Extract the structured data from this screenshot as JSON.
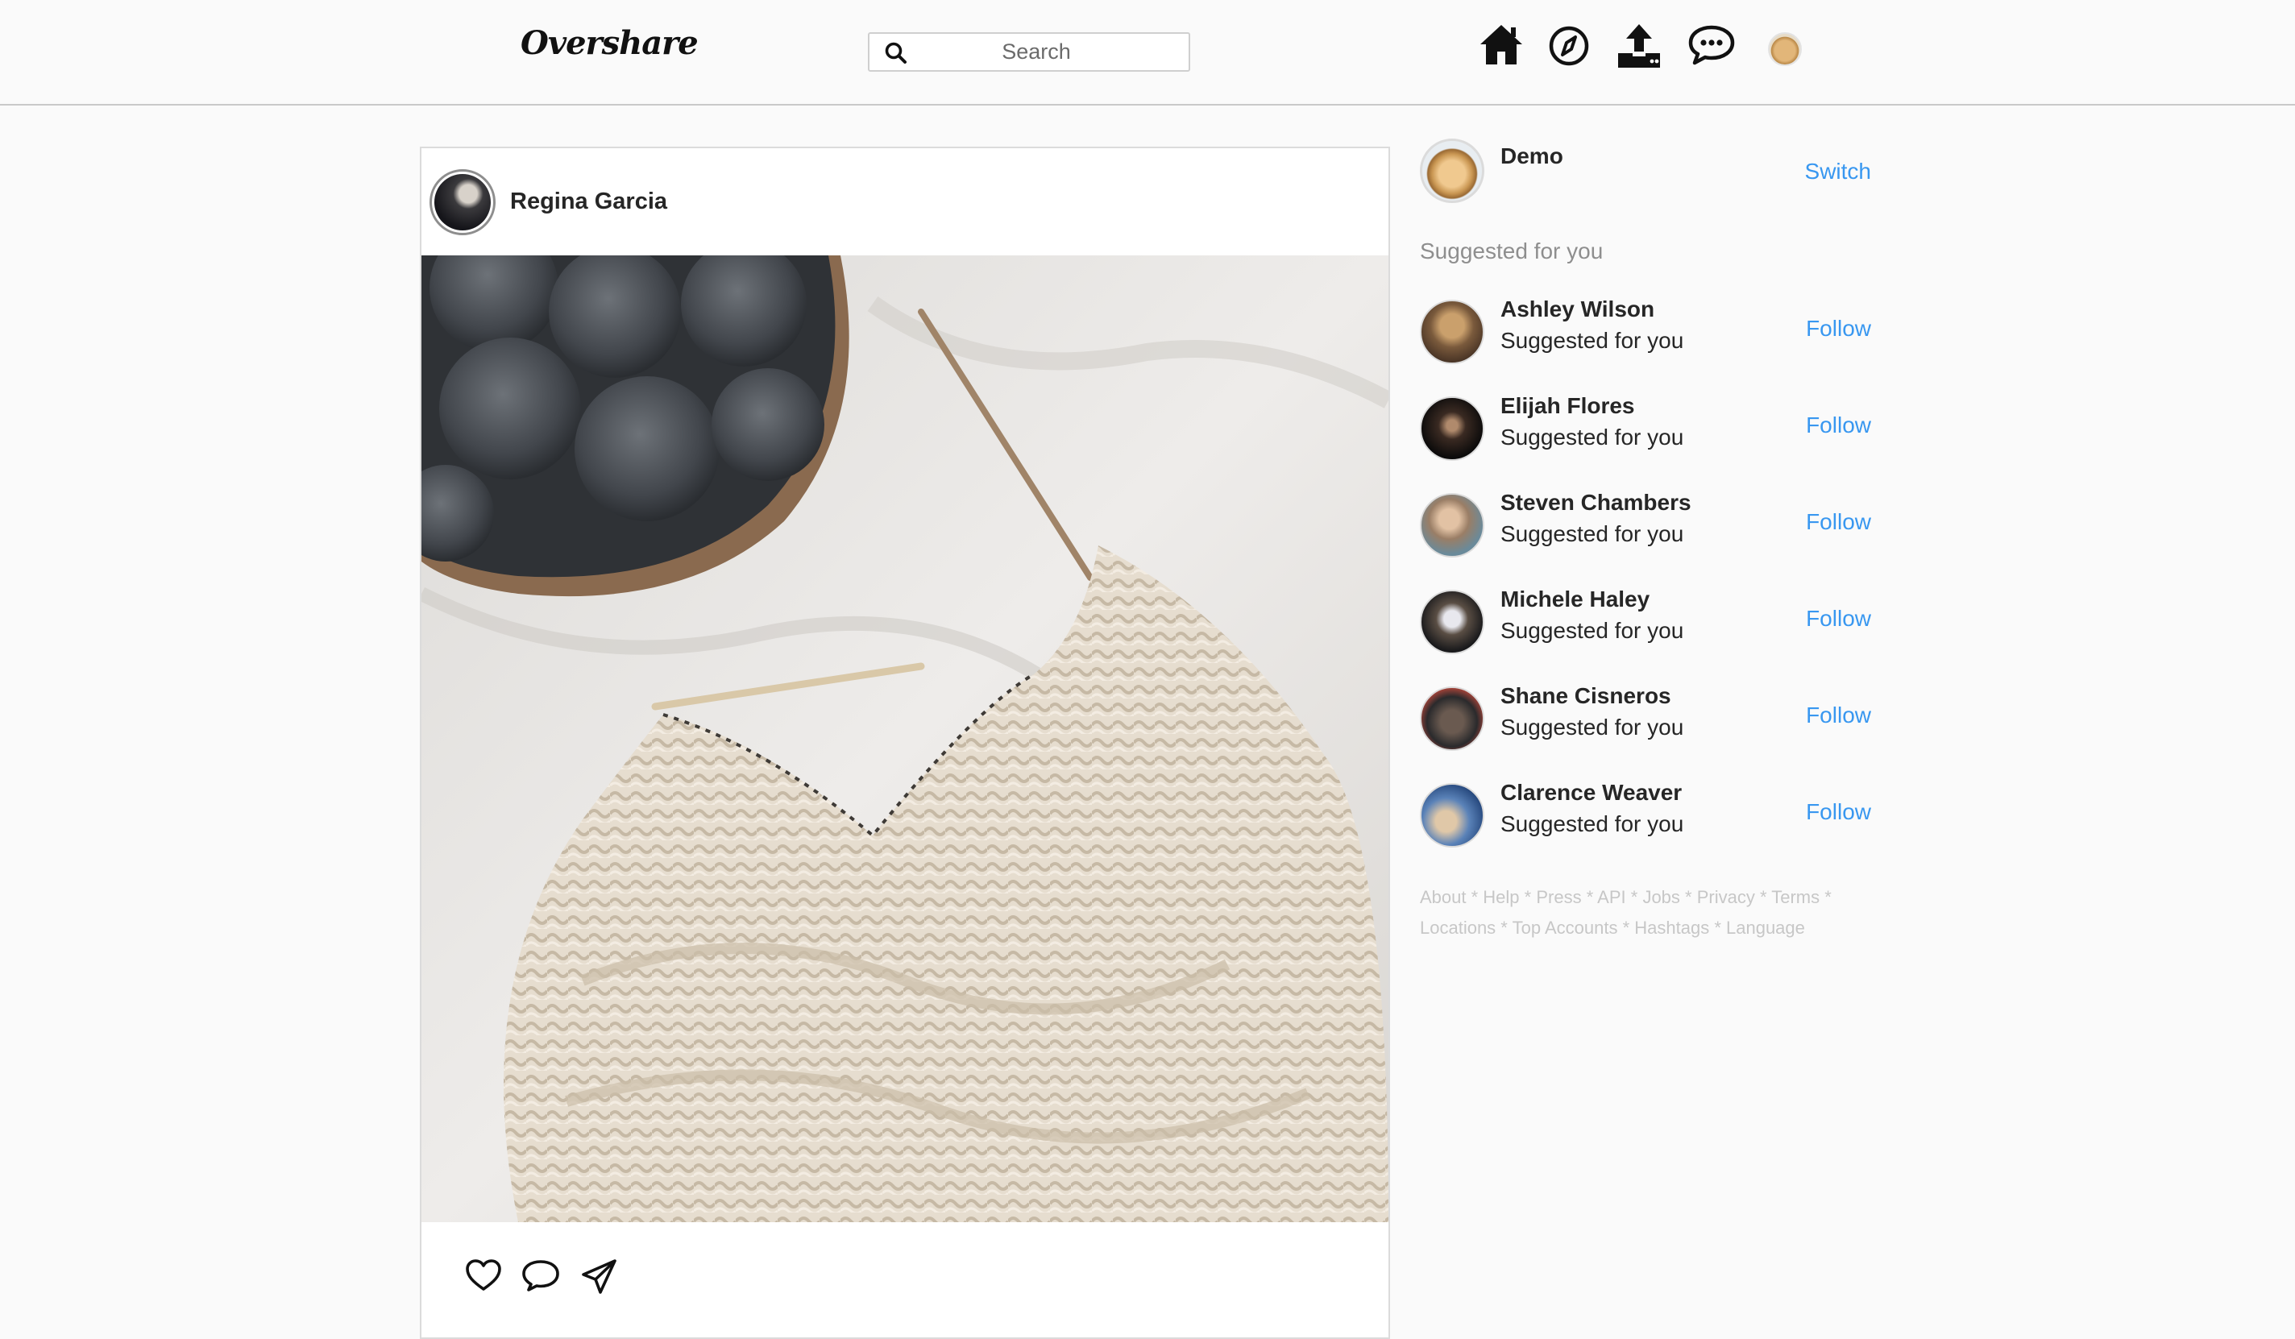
{
  "app": {
    "logo": "Overshare"
  },
  "search": {
    "placeholder": "Search",
    "value": ""
  },
  "nav": {
    "icons": [
      "home-icon",
      "explore-compass-icon",
      "upload-icon",
      "messages-icon",
      "profile-avatar"
    ]
  },
  "post": {
    "username": "Regina Garcia",
    "image_alt": "knitting",
    "actions": [
      "like-heart-icon",
      "comment-bubble-icon",
      "share-paper-plane-icon"
    ]
  },
  "sidebar": {
    "current_user": {
      "name": "Demo",
      "switch_label": "Switch"
    },
    "suggested_title": "Suggested for you",
    "suggestions": [
      {
        "name": "Ashley Wilson",
        "subtitle": "Suggested for you",
        "action": "Follow"
      },
      {
        "name": "Elijah Flores",
        "subtitle": "Suggested for you",
        "action": "Follow"
      },
      {
        "name": "Steven Chambers",
        "subtitle": "Suggested for you",
        "action": "Follow"
      },
      {
        "name": "Michele Haley",
        "subtitle": "Suggested for you",
        "action": "Follow"
      },
      {
        "name": "Shane Cisneros",
        "subtitle": "Suggested for you",
        "action": "Follow"
      },
      {
        "name": "Clarence Weaver",
        "subtitle": "Suggested for you",
        "action": "Follow"
      }
    ],
    "footer_links": [
      "About",
      "Help",
      "Press",
      "API",
      "Jobs",
      "Privacy",
      "Terms",
      "Locations",
      "Top Accounts",
      "Hashtags",
      "Language"
    ],
    "footer_separator": " * "
  },
  "colors": {
    "link": "#3897f0",
    "border": "#dbdbdb",
    "muted": "#8e8e8e",
    "background": "#fafafa"
  }
}
